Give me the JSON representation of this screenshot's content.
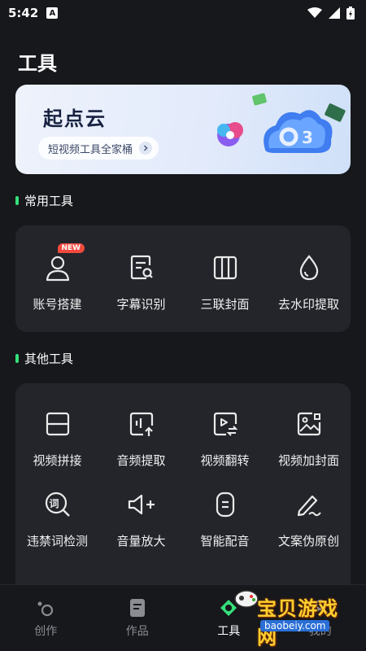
{
  "status_bar": {
    "time": "5:42",
    "app_badge": "A"
  },
  "page": {
    "title": "工具"
  },
  "banner": {
    "title": "起点云",
    "pill_label": "短视频工具全家桶",
    "arrow_icon": "chevron-right-icon"
  },
  "sections": {
    "common": {
      "label": "常用工具",
      "items": [
        {
          "label": "账号搭建",
          "icon": "user-icon",
          "badge": "NEW"
        },
        {
          "label": "字幕识别",
          "icon": "subtitle-search-icon"
        },
        {
          "label": "三联封面",
          "icon": "triple-panel-icon"
        },
        {
          "label": "去水印提取",
          "icon": "droplet-icon"
        }
      ]
    },
    "other": {
      "label": "其他工具",
      "items": [
        {
          "label": "视频拼接",
          "icon": "split-frame-icon"
        },
        {
          "label": "音频提取",
          "icon": "audio-extract-icon"
        },
        {
          "label": "视频翻转",
          "icon": "video-flip-icon"
        },
        {
          "label": "视频加封面",
          "icon": "image-cover-icon"
        },
        {
          "label": "违禁词检测",
          "icon": "word-search-icon",
          "glyph": "词"
        },
        {
          "label": "音量放大",
          "icon": "volume-up-icon"
        },
        {
          "label": "智能配音",
          "icon": "smart-dub-icon"
        },
        {
          "label": "文案伪原创",
          "icon": "pen-icon"
        }
      ]
    }
  },
  "tab_bar": {
    "tabs": [
      {
        "label": "创作",
        "icon": "create-icon"
      },
      {
        "label": "作品",
        "icon": "works-icon"
      },
      {
        "label": "工具",
        "icon": "tools-icon",
        "active": true
      },
      {
        "label": "我的",
        "icon": "profile-icon"
      }
    ]
  },
  "watermark": {
    "title": "宝贝游戏网",
    "url": "baobeiy.com"
  },
  "colors": {
    "accent_green": "#35e07a",
    "badge_red": "#f04a3e",
    "card_bg": "#23252b"
  }
}
